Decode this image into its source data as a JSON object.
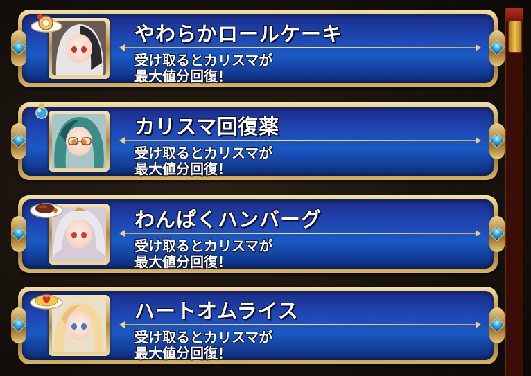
{
  "items": [
    {
      "name": "やわらかロールケーキ",
      "description_line1": "受け取るとカリスマが",
      "description_line2": "最大値分回復！",
      "icon": "roll-cake-icon",
      "portrait": "portrait-white-hair-girl",
      "hair_color": "#e8e4e6",
      "accent_color": "#2a2a2e",
      "eye_color": "#c8323c",
      "bg_color": "#6a5a55"
    },
    {
      "name": "カリスマ回復薬",
      "description_line1": "受け取るとカリスマが",
      "description_line2": "最大値分回復！",
      "icon": "potion-bottle-icon",
      "portrait": "portrait-teal-hair-glasses-girl",
      "hair_color": "#3c8c8a",
      "accent_color": "#1e5a5a",
      "eye_color": "#c9962a",
      "bg_color": "#a8c6c8"
    },
    {
      "name": "わんぱくハンバーグ",
      "description_line1": "受け取るとカリスマが",
      "description_line2": "最大値分回復！",
      "icon": "hamburg-steak-icon",
      "portrait": "portrait-silver-hair-girl",
      "hair_color": "#e9e6ee",
      "accent_color": "#c9c3d6",
      "eye_color": "#d23a3a",
      "bg_color": "#d8cbd8"
    },
    {
      "name": "ハートオムライス",
      "description_line1": "受け取るとカリスマが",
      "description_line2": "最大値分回復！",
      "icon": "omurice-heart-icon",
      "portrait": "portrait-blonde-girl",
      "hair_color": "#f3d9a0",
      "accent_color": "#e8c07a",
      "eye_color": "#4a78c8",
      "bg_color": "#eadfc8"
    }
  ],
  "scrollbar": {
    "position": 0.0
  }
}
